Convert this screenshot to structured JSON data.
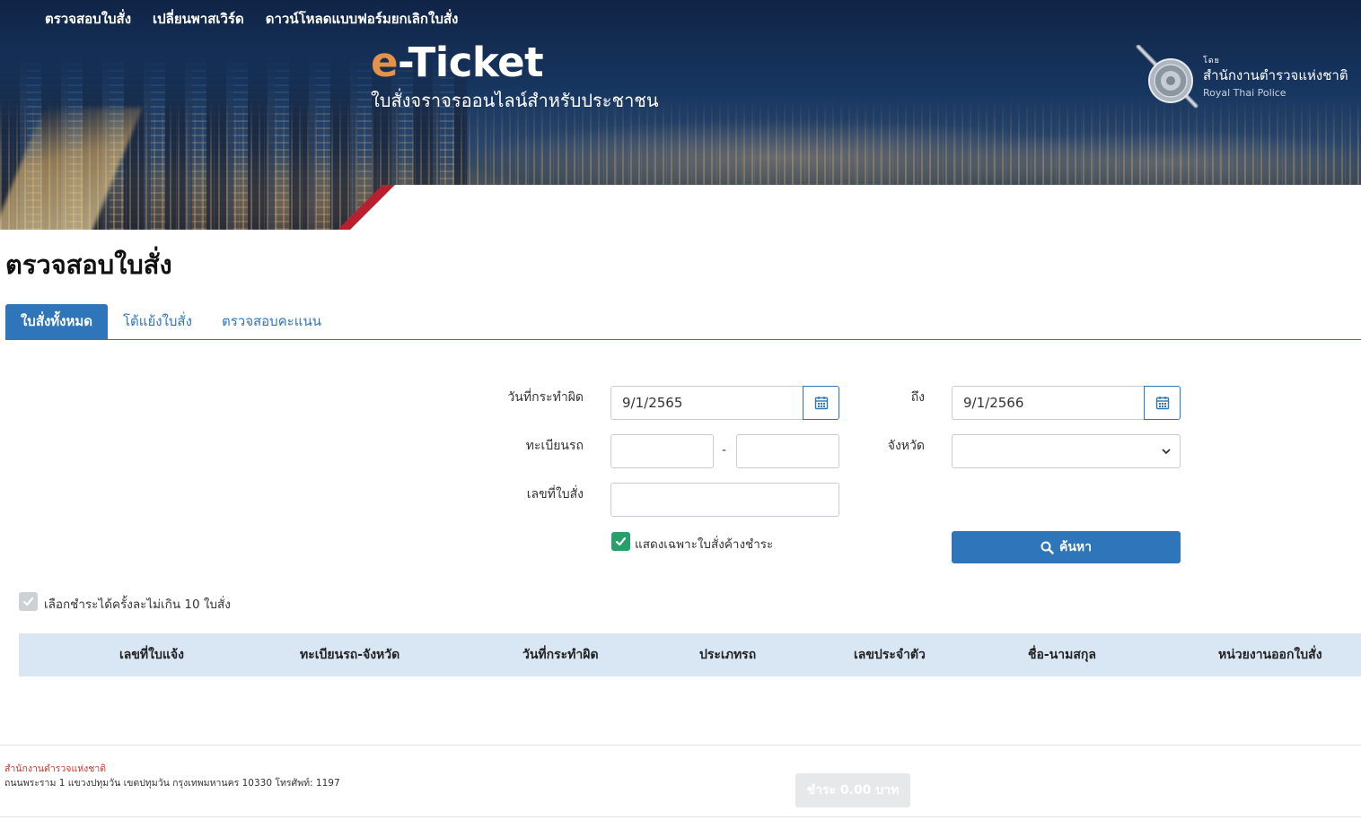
{
  "nav": {
    "items": [
      {
        "label": "ตรวจสอบใบสั่ง"
      },
      {
        "label": "เปลี่ยนพาสเวิร์ด"
      },
      {
        "label": "ดาวน์โหลดแบบฟอร์มยกเลิกใบสั่ง"
      }
    ]
  },
  "brand": {
    "title_prefix": "e",
    "title_rest": "-Ticket",
    "subtitle": "ใบสั่งจราจรออนไลน์สำหรับประชาชน",
    "prefix_color": "#e4924a"
  },
  "police": {
    "small_label": "โดย",
    "name_th": "สำนักงานตำรวจแห่งชาติ",
    "name_en": "Royal Thai Police"
  },
  "page": {
    "title": "ตรวจสอบใบสั่ง"
  },
  "tabs": [
    {
      "label": "ใบสั่งทั้งหมด",
      "active": true
    },
    {
      "label": "โต้แย้งใบสั่ง",
      "active": false
    },
    {
      "label": "ตรวจสอบคะแนน",
      "active": false
    }
  ],
  "form": {
    "offense_date_label": "วันที่กระทำผิด",
    "date_from": "9/1/2565",
    "to_label": "ถึง",
    "date_to": "9/1/2566",
    "plate_label": "ทะเบียนรถ",
    "plate_part1": "",
    "plate_part2": "",
    "plate_separator": "-",
    "province_label": "จังหวัด",
    "province_value": "",
    "ticket_no_label": "เลขที่ใบสั่ง",
    "ticket_no": "",
    "unpaid_only_label": "แสดงเฉพาะใบสั่งค้างชำระ",
    "unpaid_only_checked": true,
    "search_label": "ค้นหา",
    "calendar_icon": "calendar-icon",
    "search_icon": "search-icon"
  },
  "selection": {
    "label": "เลือกชำระได้ครั้งละไม่เกิน 10 ใบสั่ง",
    "checked": true
  },
  "table": {
    "columns": [
      "เลขที่ใบแจ้ง",
      "ทะเบียนรถ-จังหวัด",
      "วันที่กระทำผิด",
      "ประเภทรถ",
      "เลขประจำตัว",
      "ชื่อ-นามสกุล",
      "หน่วยงานออกใบสั่ง"
    ],
    "rows": []
  },
  "footer": {
    "org": "สำนักงานตำรวจแห่งชาติ",
    "address": "ถนนพระราม 1 แขวงปทุมวัน เขตปทุมวัน กรุงเทพมหานคร 10330 โทรศัพท์: 1197",
    "pay_label": "ชำระ 0.00 บาท"
  },
  "colors": {
    "primary": "#2e75b9",
    "header_bg": "#d9e6f4",
    "check_green": "#27a06a",
    "accent_red": "#b81f2f",
    "banner_dark": "#16355f"
  }
}
